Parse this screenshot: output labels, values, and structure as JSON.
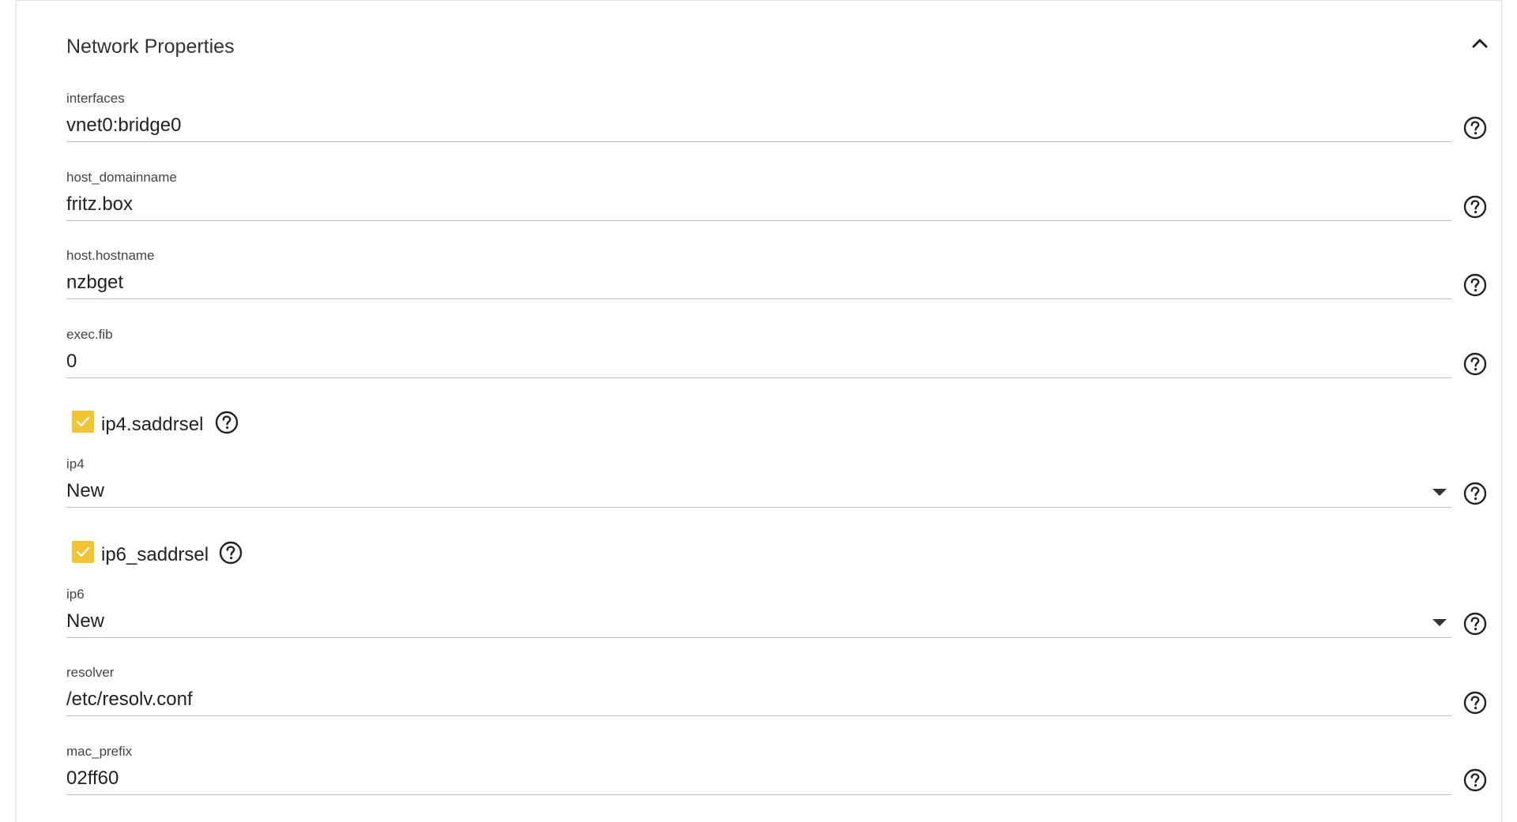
{
  "panel": {
    "title": "Network Properties",
    "collapse_icon": "chevron-up-icon"
  },
  "help_icon": "question-circle-icon",
  "fields": {
    "interfaces": {
      "label": "interfaces",
      "value": "vnet0:bridge0"
    },
    "host_domainname": {
      "label": "host_domainname",
      "value": "fritz.box"
    },
    "host_hostname": {
      "label": "host.hostname",
      "value": "nzbget"
    },
    "exec_fib": {
      "label": "exec.fib",
      "value": "0"
    },
    "ip4": {
      "label": "ip4",
      "selected": "New"
    },
    "ip6": {
      "label": "ip6",
      "selected": "New"
    },
    "resolver": {
      "label": "resolver",
      "value": "/etc/resolv.conf"
    },
    "mac_prefix": {
      "label": "mac_prefix",
      "value": "02ff60"
    }
  },
  "checkboxes": {
    "ip4_saddrsel": {
      "label": "ip4.saddrsel",
      "checked": true
    },
    "ip6_saddrsel": {
      "label": "ip6_saddrsel",
      "checked": true
    }
  },
  "colors": {
    "checkbox_accent": "#f1c433",
    "underline": "#bdbdbd",
    "text": "#222222"
  }
}
